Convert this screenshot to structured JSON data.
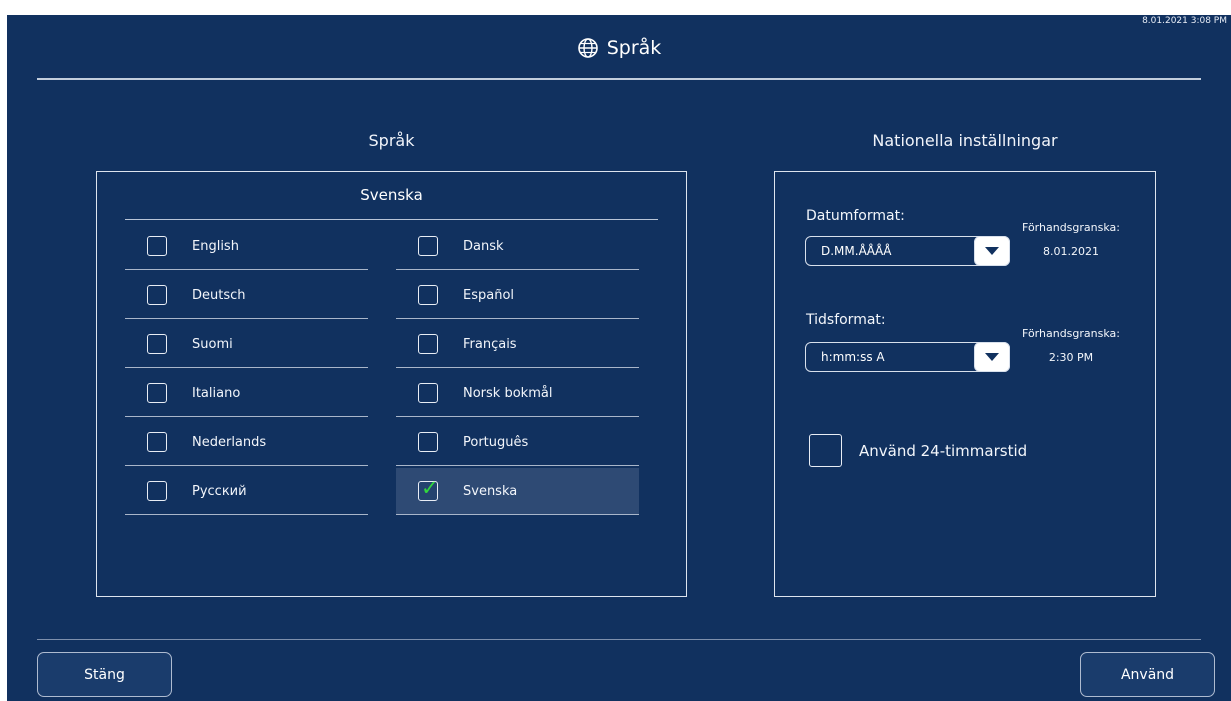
{
  "status": {
    "timestamp": "8.01.2021 3:08 PM"
  },
  "header": {
    "title": "Språk",
    "icon": "globe-icon"
  },
  "language_section": {
    "heading": "Språk",
    "current_language": "Svenska",
    "languages": [
      {
        "label": "English",
        "checked": false
      },
      {
        "label": "Deutsch",
        "checked": false
      },
      {
        "label": "Suomi",
        "checked": false
      },
      {
        "label": "Italiano",
        "checked": false
      },
      {
        "label": "Nederlands",
        "checked": false
      },
      {
        "label": "Русский",
        "checked": false
      },
      {
        "label": "Dansk",
        "checked": false
      },
      {
        "label": "Español",
        "checked": false
      },
      {
        "label": "Français",
        "checked": false
      },
      {
        "label": "Norsk bokmål",
        "checked": false
      },
      {
        "label": "Português",
        "checked": false
      },
      {
        "label": "Svenska",
        "checked": true
      }
    ]
  },
  "national_section": {
    "heading": "Nationella inställningar",
    "date_format": {
      "label": "Datumformat:",
      "value": "D.MM.ÅÅÅÅ",
      "preview_label": "Förhandsgranska:",
      "preview_value": "8.01.2021"
    },
    "time_format": {
      "label": "Tidsformat:",
      "value": "h:mm:ss A",
      "preview_label": "Förhandsgranska:",
      "preview_value": "2:30 PM"
    },
    "use_24h": {
      "label": "Använd 24-timmarstid",
      "checked": false
    }
  },
  "footer": {
    "close_label": "Stäng",
    "apply_label": "Använd"
  },
  "colors": {
    "background": "#11315f",
    "selected_row": "#2e4a74",
    "check": "#32d63e"
  }
}
